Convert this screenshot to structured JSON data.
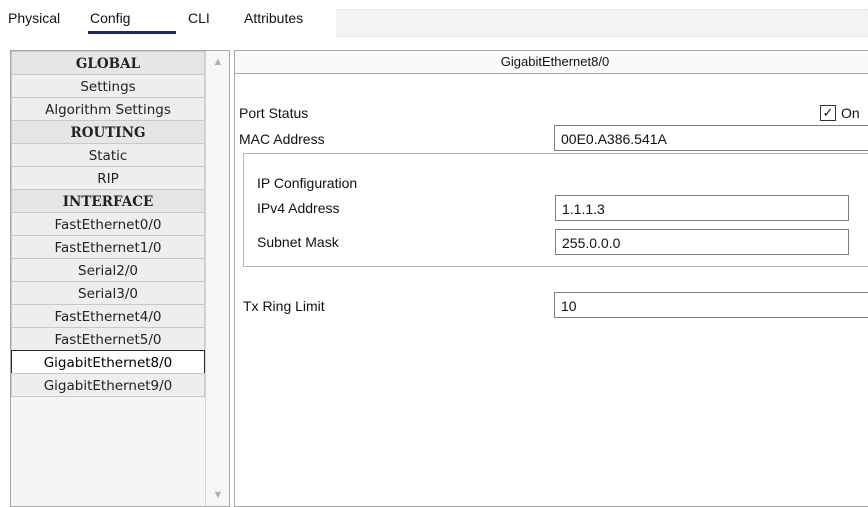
{
  "tabs": {
    "physical": "Physical",
    "config": "Config",
    "cli": "CLI",
    "attributes": "Attributes"
  },
  "sidebar": {
    "items": [
      {
        "label": "GLOBAL",
        "header": true
      },
      {
        "label": "Settings"
      },
      {
        "label": "Algorithm Settings"
      },
      {
        "label": "ROUTING",
        "header": true
      },
      {
        "label": "Static"
      },
      {
        "label": "RIP"
      },
      {
        "label": "INTERFACE",
        "header": true
      },
      {
        "label": "FastEthernet0/0"
      },
      {
        "label": "FastEthernet1/0"
      },
      {
        "label": "Serial2/0"
      },
      {
        "label": "Serial3/0"
      },
      {
        "label": "FastEthernet4/0"
      },
      {
        "label": "FastEthernet5/0"
      },
      {
        "label": "GigabitEthernet8/0",
        "selected": true
      },
      {
        "label": "GigabitEthernet9/0"
      }
    ]
  },
  "main": {
    "title": "GigabitEthernet8/0",
    "port_status_label": "Port Status",
    "port_status_checked": true,
    "port_status_on": "On",
    "mac_label": "MAC Address",
    "mac_value": "00E0.A386.541A",
    "ip_config_label": "IP Configuration",
    "ipv4_label": "IPv4 Address",
    "ipv4_value": "1.1.1.3",
    "subnet_label": "Subnet Mask",
    "subnet_value": "255.0.0.0",
    "tx_label": "Tx Ring Limit",
    "tx_value": "10"
  },
  "icons": {
    "checkmark": "✓",
    "scroll_up": "▲",
    "scroll_down": "▼"
  },
  "colors": {
    "active_tab_underline": "#1a2a70"
  }
}
